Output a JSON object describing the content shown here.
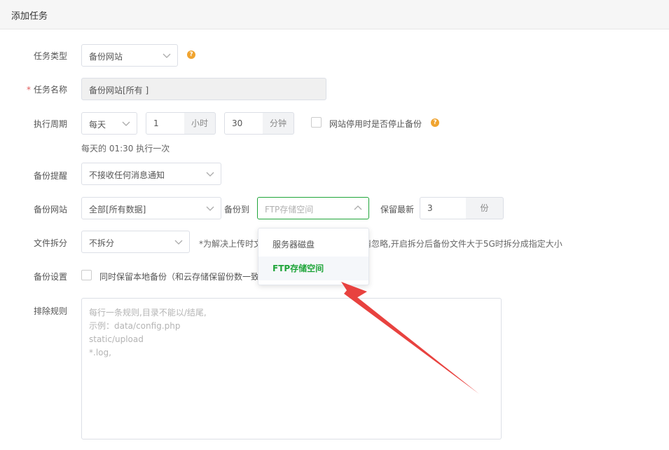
{
  "header": {
    "title": "添加任务"
  },
  "form": {
    "task_type": {
      "label": "任务类型",
      "value": "备份网站"
    },
    "task_name": {
      "label": "任务名称",
      "required": "*",
      "value": "备份网站[所有 ]"
    },
    "cycle": {
      "label": "执行周期",
      "period_value": "每天",
      "hour_value": "1",
      "hour_unit": "小时",
      "minute_value": "30",
      "minute_unit": "分钟",
      "stop_label": "网站停用时是否停止备份",
      "hint": "每天的 01:30 执行一次"
    },
    "reminder": {
      "label": "备份提醒",
      "value": "不接收任何消息通知"
    },
    "backup_site": {
      "label": "备份网站",
      "site_value": "全部[所有数据]",
      "to_label": "备份到",
      "to_value": "FTP存储空间",
      "keep_label": "保留最新",
      "keep_value": "3",
      "keep_unit": "份"
    },
    "split": {
      "label": "文件拆分",
      "value": "不拆分",
      "note_left": "*为解决上传时文",
      "note_right": "请忽略,开启拆分后备份文件大于5G时拆分成指定大小"
    },
    "settings": {
      "label": "备份设置",
      "checkbox_label": "同时保留本地备份（和云存储保留份数一致"
    },
    "exclude": {
      "label": "排除规则",
      "placeholder": "每行一条规则,目录不能以/结尾,\n示例：data/config.php\nstatic/upload\n*.log,"
    }
  },
  "dropdown": {
    "options": [
      {
        "label": "服务器磁盘"
      },
      {
        "label": "FTP存储空间"
      }
    ]
  },
  "colors": {
    "accent": "#20a53a",
    "help": "#f0a430",
    "arrow": "#e8423f",
    "required": "#e15c5c"
  },
  "icons": {
    "chevron": "chevron-down-icon",
    "chevron_up": "chevron-up-icon",
    "help": "help-icon"
  }
}
